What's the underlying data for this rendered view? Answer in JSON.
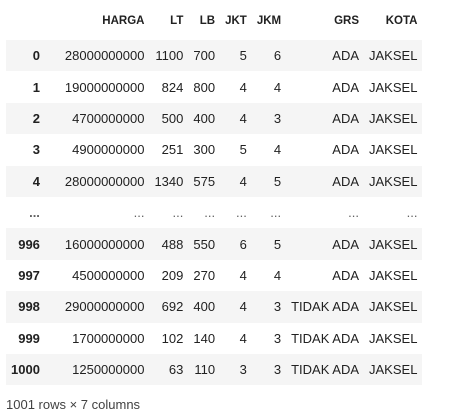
{
  "columns": [
    "",
    "HARGA",
    "LT",
    "LB",
    "JKT",
    "JKM",
    "GRS",
    "KOTA"
  ],
  "rows": [
    {
      "index": "0",
      "cells": [
        "28000000000",
        "1100",
        "700",
        "5",
        "6",
        "ADA",
        "JAKSEL"
      ]
    },
    {
      "index": "1",
      "cells": [
        "19000000000",
        "824",
        "800",
        "4",
        "4",
        "ADA",
        "JAKSEL"
      ]
    },
    {
      "index": "2",
      "cells": [
        "4700000000",
        "500",
        "400",
        "4",
        "3",
        "ADA",
        "JAKSEL"
      ]
    },
    {
      "index": "3",
      "cells": [
        "4900000000",
        "251",
        "300",
        "5",
        "4",
        "ADA",
        "JAKSEL"
      ]
    },
    {
      "index": "4",
      "cells": [
        "28000000000",
        "1340",
        "575",
        "4",
        "5",
        "ADA",
        "JAKSEL"
      ]
    },
    {
      "index": "...",
      "cells": [
        "...",
        "...",
        "...",
        "...",
        "...",
        "...",
        "..."
      ]
    },
    {
      "index": "996",
      "cells": [
        "16000000000",
        "488",
        "550",
        "6",
        "5",
        "ADA",
        "JAKSEL"
      ]
    },
    {
      "index": "997",
      "cells": [
        "4500000000",
        "209",
        "270",
        "4",
        "4",
        "ADA",
        "JAKSEL"
      ]
    },
    {
      "index": "998",
      "cells": [
        "29000000000",
        "692",
        "400",
        "4",
        "3",
        "TIDAK ADA",
        "JAKSEL"
      ]
    },
    {
      "index": "999",
      "cells": [
        "1700000000",
        "102",
        "140",
        "4",
        "3",
        "TIDAK ADA",
        "JAKSEL"
      ]
    },
    {
      "index": "1000",
      "cells": [
        "1250000000",
        "63",
        "110",
        "3",
        "3",
        "TIDAK ADA",
        "JAKSEL"
      ]
    }
  ],
  "shape_text": "1001 rows × 7 columns"
}
